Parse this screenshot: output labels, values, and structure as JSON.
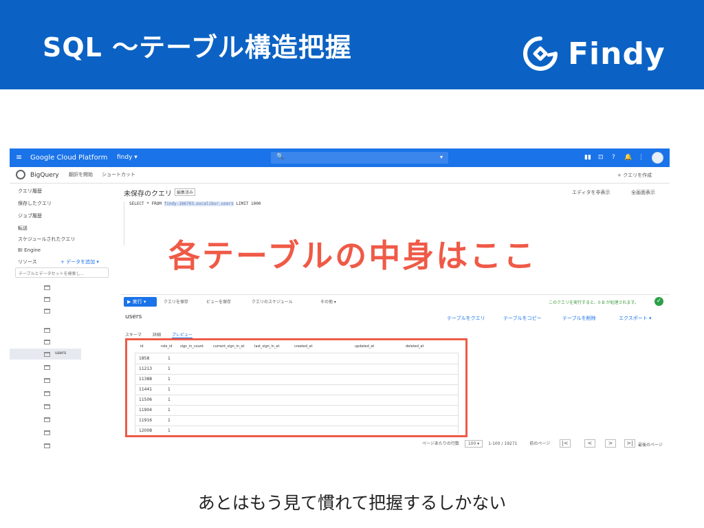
{
  "slide": {
    "title": "SQL 〜テーブル構造把握",
    "logo_text": "Findy",
    "overlay_text": "各テーブルの中身はここ",
    "caption": "あとはもう見て慣れて把握するしかない"
  },
  "colors": {
    "header_bg": "#0b62c4",
    "overlay": "#ef5a47",
    "gcp_bar": "#1a73e8"
  },
  "icons": {
    "menu": "hamburger-menu-icon",
    "search": "search-icon",
    "status": "check-circle-icon"
  },
  "gcp": {
    "menu_glyph": "≡",
    "platform_title": "Google Cloud Platform",
    "project": "findy ▾",
    "search_glyph": "🔍",
    "search_caret": "▾",
    "toolbar_glyphs": [
      "▮▮",
      "⊡",
      "?",
      "🔔",
      "⋮"
    ]
  },
  "bigquery": {
    "name": "BigQuery",
    "buttons": [
      "翻訳を開始",
      "ショートカット"
    ],
    "compose": "+ クエリを作成"
  },
  "sidebar": {
    "items": [
      "クエリ履歴",
      "保存したクエリ",
      "ジョブ履歴",
      "転送",
      "スケジュールされたクエリ",
      "BI Engine",
      "リソース"
    ],
    "add_data": "+ データを追加 ▾",
    "search_placeholder": "テーブルとデータセットを検索し…",
    "highlighted_table": "users"
  },
  "query_editor": {
    "title": "未保存のクエリ",
    "badge": "編集済み",
    "editor_btn": "エディタを非表示",
    "fullscreen_btn": "全画面表示",
    "sql_prefix": "SELECT * FROM",
    "sql_table": "findy-186703.excalibur.users",
    "sql_suffix": "LIMIT 1000"
  },
  "toolbar": {
    "run": "▶ 実行 ▾",
    "save_query": "クエリを保存",
    "save_view": "ビューを保存",
    "schedule": "クエリのスケジュール",
    "more": "その他 ▾",
    "status": "このクエリを実行すると、0 B が処理されます。",
    "check_glyph": "✓"
  },
  "table_panel": {
    "name": "users",
    "actions": [
      "テーブルをクエリ",
      "テーブルをコピー",
      "テーブルを削除",
      "エクスポート ▾"
    ],
    "tabs": [
      "スキーマ",
      "詳細",
      "プレビュー"
    ]
  },
  "grid": {
    "columns": [
      "id",
      "role_id",
      "sign_in_count",
      "current_sign_in_at",
      "last_sign_in_at",
      "created_at",
      "updated_at",
      "deleted_at"
    ],
    "rows": [
      {
        "id": "1858",
        "role_id": "1"
      },
      {
        "id": "11213",
        "role_id": "1"
      },
      {
        "id": "11388",
        "role_id": "1"
      },
      {
        "id": "11441",
        "role_id": "1"
      },
      {
        "id": "11506",
        "role_id": "1"
      },
      {
        "id": "11904",
        "role_id": "1"
      },
      {
        "id": "11916",
        "role_id": "1"
      },
      {
        "id": "12008",
        "role_id": "1"
      }
    ]
  },
  "pager": {
    "label": "ページあたりの行数",
    "size": "100 ▾",
    "range": "1-100 / 19271",
    "prev_label": "前のページ",
    "first_glyph": "|<",
    "prev_glyph": "<",
    "next_glyph": ">",
    "last_label": "最後のページ",
    "last_glyph": ">|"
  }
}
